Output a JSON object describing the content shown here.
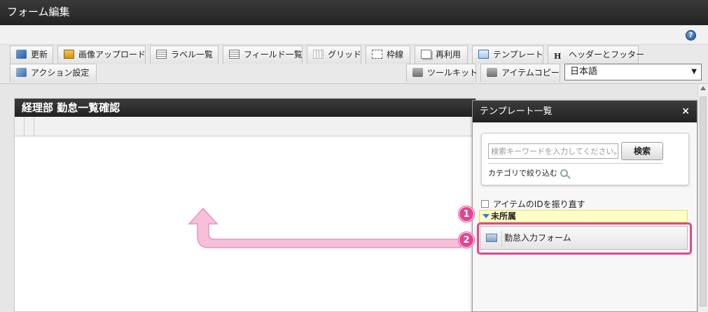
{
  "window": {
    "title": "フォーム編集"
  },
  "help": {
    "icon": "help-icon",
    "glyph": "?"
  },
  "toolbar": {
    "row1": [
      {
        "label": "更新",
        "icon": "refresh-icon"
      },
      {
        "label": "画像アップロード",
        "icon": "image-upload-icon"
      },
      {
        "label": "ラベル一覧",
        "icon": "label-list-icon"
      },
      {
        "label": "フィールド一覧",
        "icon": "field-list-icon"
      },
      {
        "label": "グリッド",
        "icon": "grid-icon"
      },
      {
        "label": "枠線",
        "icon": "border-icon"
      },
      {
        "label": "再利用",
        "icon": "reuse-icon"
      },
      {
        "label": "テンプレート",
        "icon": "template-icon"
      },
      {
        "label": "ヘッダーとフッター",
        "icon": "header-footer-icon",
        "glyph": "H"
      }
    ],
    "row2": [
      {
        "label": "アクション設定",
        "icon": "action-icon"
      },
      {
        "label": "ツールキット",
        "icon": "toolkit-icon"
      },
      {
        "label": "アイテムコピー",
        "icon": "item-copy-icon"
      }
    ],
    "language": {
      "value": "日本語",
      "arrow": "▼"
    }
  },
  "form": {
    "title": "経理部 勤怠一覧確認"
  },
  "template_panel": {
    "title": "テンプレート一覧",
    "close_glyph": "×",
    "search": {
      "placeholder": "検索キーワードを入力してください。",
      "button": "検索",
      "filter_label": "カテゴリで絞り込む"
    },
    "reassign_label": "アイテムのIDを振り直す",
    "folder": "未所属",
    "item": "勤怠入力フォーム"
  },
  "callouts": [
    "1",
    "2"
  ],
  "colors": {
    "accent": "#e4458f",
    "header": "#2a2a2a",
    "arrow": "#f7bfd9"
  }
}
